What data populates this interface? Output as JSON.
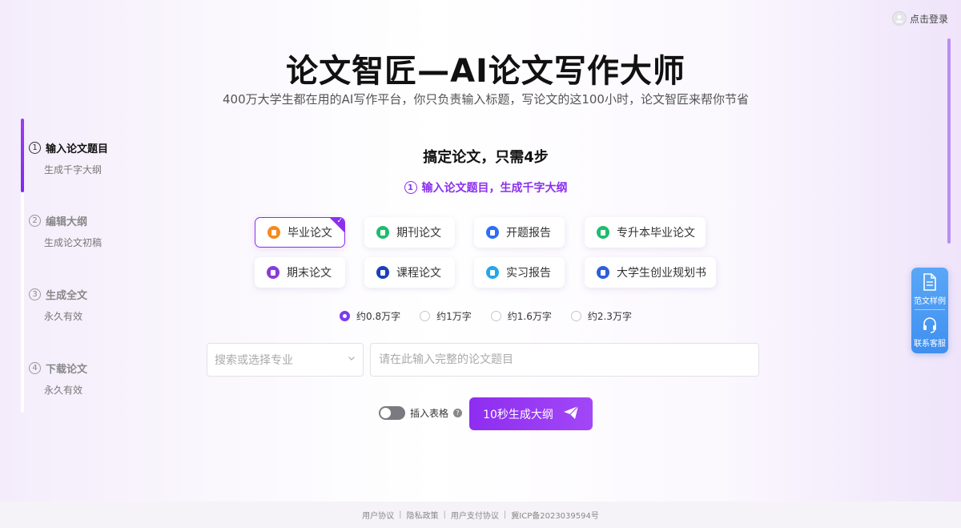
{
  "header": {
    "login_label": "点击登录",
    "avatar_icon": "user-icon"
  },
  "hero": {
    "title": "论文智匠—AI论文写作大师",
    "subtitle": "400万大学生都在用的AI写作平台，你只负责输入标题，写论文的这100小时，论文智匠来帮你节省"
  },
  "steps": [
    {
      "num": "1",
      "title": "输入论文题目",
      "desc": "生成千字大纲",
      "active": true
    },
    {
      "num": "2",
      "title": "编辑大纲",
      "desc": "生成论文初稿",
      "active": false
    },
    {
      "num": "3",
      "title": "生成全文",
      "desc": "永久有效",
      "active": false
    },
    {
      "num": "4",
      "title": "下载论文",
      "desc": "永久有效",
      "active": false
    }
  ],
  "main": {
    "heading": "搞定论文，只需4步",
    "current_step_num": "1",
    "current_step": "输入论文题目，生成千字大纲"
  },
  "paper_types": [
    {
      "label": "毕业论文",
      "icon": "graduation-paper-icon",
      "color": "#f58a1f",
      "selected": true
    },
    {
      "label": "期刊论文",
      "icon": "journal-icon",
      "color": "#1fbd6e",
      "selected": false
    },
    {
      "label": "开题报告",
      "icon": "report-icon",
      "color": "#2d6ff0",
      "selected": false
    },
    {
      "label": "专升本毕业论文",
      "icon": "book-icon",
      "color": "#1fbd6e",
      "selected": false
    },
    {
      "label": "期末论文",
      "icon": "exam-paper-icon",
      "color": "#8a3bd9",
      "selected": false
    },
    {
      "label": "课程论文",
      "icon": "course-icon",
      "color": "#1a3fb8",
      "selected": false
    },
    {
      "label": "实习报告",
      "icon": "internship-icon",
      "color": "#23a7ea",
      "selected": false
    },
    {
      "label": "大学生创业规划书",
      "icon": "plan-icon",
      "color": "#2e5fd8",
      "selected": false
    }
  ],
  "word_counts": [
    {
      "label": "约0.8万字",
      "selected": true
    },
    {
      "label": "约1万字",
      "selected": false
    },
    {
      "label": "约1.6万字",
      "selected": false
    },
    {
      "label": "约2.3万字",
      "selected": false
    }
  ],
  "form": {
    "major_placeholder": "搜索或选择专业",
    "title_placeholder": "请在此输入完整的论文题目",
    "insert_table_label": "插入表格",
    "generate_label": "10秒生成大纲"
  },
  "float_panel": {
    "sample_label": "范文样例",
    "service_label": "联系客服"
  },
  "footer": {
    "links": [
      "用户协议",
      "隐私政策",
      "用户支付协议",
      "冀ICP备2023039594号"
    ]
  }
}
